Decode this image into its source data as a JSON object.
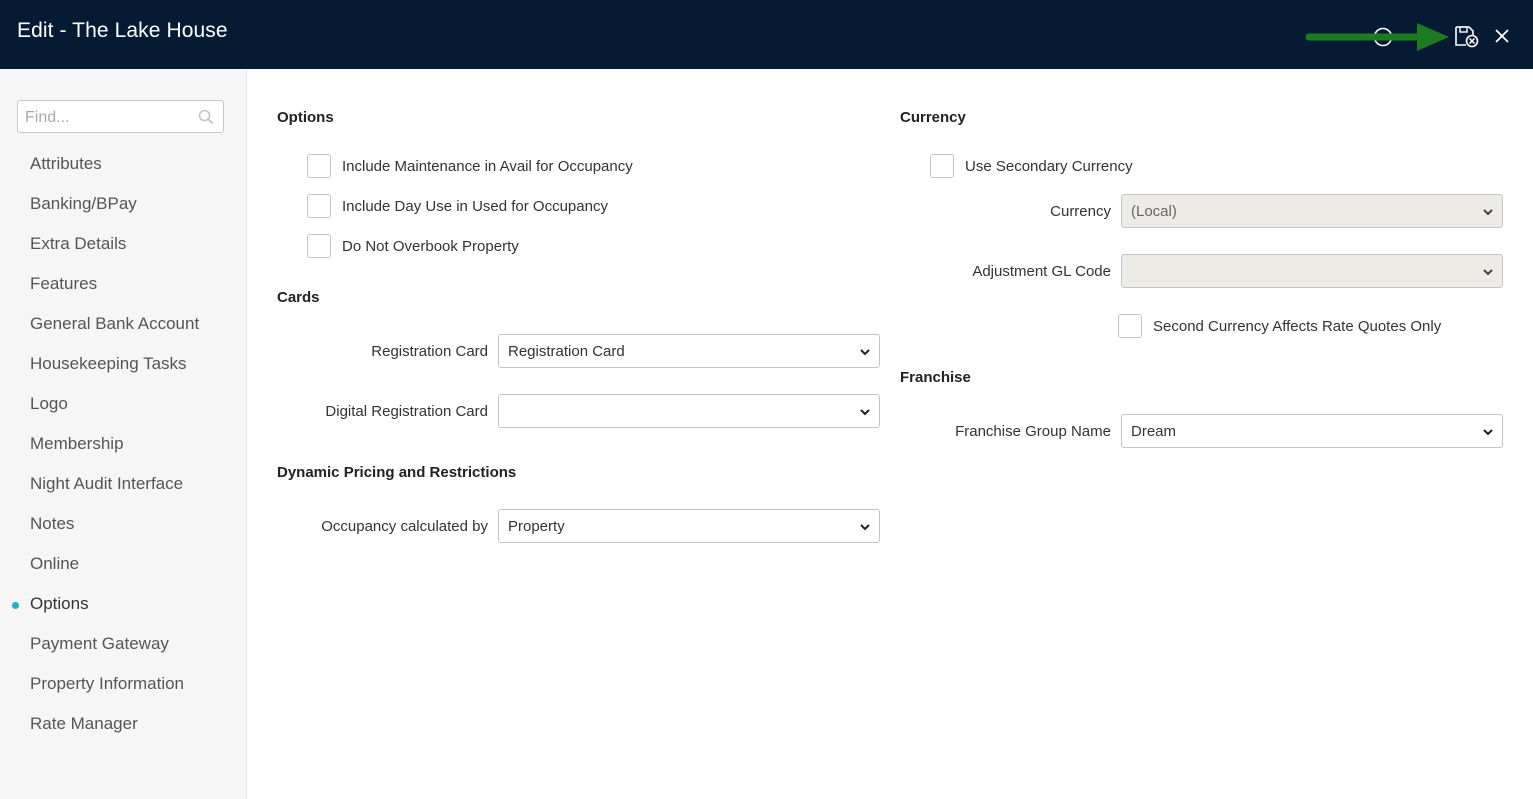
{
  "header": {
    "title": "Edit - The Lake House",
    "icons": [
      "help-icon",
      "save-close-icon",
      "close-icon"
    ]
  },
  "sidebar": {
    "search_placeholder": "Find...",
    "items": [
      {
        "label": "Attributes"
      },
      {
        "label": "Banking/BPay"
      },
      {
        "label": "Extra Details"
      },
      {
        "label": "Features"
      },
      {
        "label": "General Bank Account"
      },
      {
        "label": "Housekeeping Tasks"
      },
      {
        "label": "Logo"
      },
      {
        "label": "Membership"
      },
      {
        "label": "Night Audit Interface"
      },
      {
        "label": "Notes"
      },
      {
        "label": "Online"
      },
      {
        "label": "Options",
        "active": true
      },
      {
        "label": "Payment Gateway"
      },
      {
        "label": "Property Information"
      },
      {
        "label": "Rate Manager"
      }
    ]
  },
  "options": {
    "title": "Options",
    "checkboxes": [
      {
        "label": "Include Maintenance in Avail for Occupancy",
        "checked": false
      },
      {
        "label": "Include Day Use in Used for Occupancy",
        "checked": false
      },
      {
        "label": "Do Not Overbook Property",
        "checked": false
      }
    ]
  },
  "cards": {
    "title": "Cards",
    "registration_card": {
      "label": "Registration Card",
      "value": "Registration Card"
    },
    "digital_registration_card": {
      "label": "Digital Registration Card",
      "value": ""
    }
  },
  "dynamic_pricing": {
    "title": "Dynamic Pricing and Restrictions",
    "occupancy": {
      "label": "Occupancy calculated by",
      "value": "Property"
    }
  },
  "currency": {
    "title": "Currency",
    "use_secondary": {
      "label": "Use Secondary Currency",
      "checked": false
    },
    "currency": {
      "label": "Currency",
      "value": "(Local)"
    },
    "adjustment_gl": {
      "label": "Adjustment GL Code",
      "value": ""
    },
    "second_affects": {
      "label": "Second Currency Affects Rate Quotes Only",
      "checked": false
    }
  },
  "franchise": {
    "title": "Franchise",
    "group_name": {
      "label": "Franchise Group Name",
      "value": "Dream"
    }
  },
  "colors": {
    "header_bg": "#061b33",
    "accent": "#1fb1c7",
    "annotation_arrow": "#1e7a22"
  }
}
